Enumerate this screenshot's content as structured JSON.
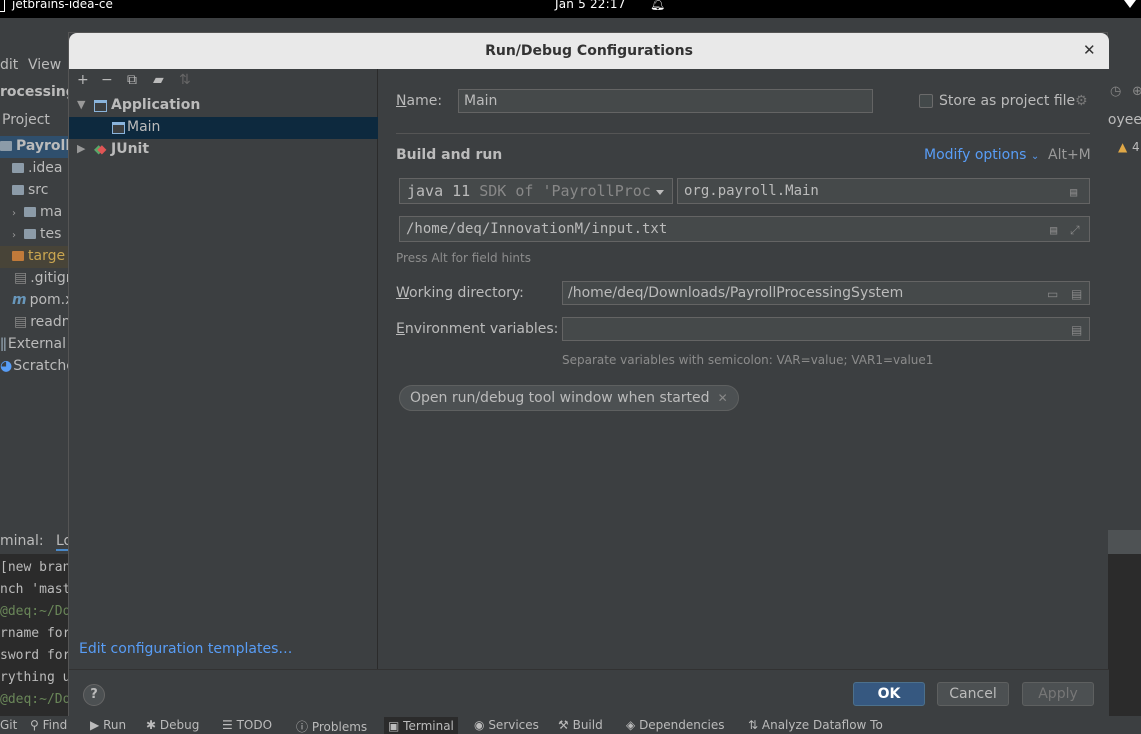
{
  "os": {
    "app_name": "jetbrains-idea-ce",
    "clock": "Jan 5  22:17"
  },
  "ide": {
    "menu": [
      "dit",
      "View"
    ],
    "project_title": "rocessing",
    "project_tab": "Project",
    "tree": [
      {
        "label": "PayrollP",
        "kind": "root"
      },
      {
        "label": ".idea",
        "kind": "folder"
      },
      {
        "label": "src",
        "kind": "folder"
      },
      {
        "label": "ma",
        "kind": "folder"
      },
      {
        "label": "tes",
        "kind": "folder"
      },
      {
        "label": "targe",
        "kind": "folder-orange"
      },
      {
        "label": ".gitign",
        "kind": "file"
      },
      {
        "label": "pom.x",
        "kind": "maven"
      },
      {
        "label": "readn",
        "kind": "file"
      },
      {
        "label": "External",
        "kind": "lib"
      },
      {
        "label": "Scratche",
        "kind": "scratch"
      }
    ],
    "terminal_tab": "minal:",
    "terminal_tab2": "Lo",
    "terminal_lines": [
      "[new bran",
      "nch 'mast",
      "@deq:~/Do",
      "rname for",
      "sword for",
      "rything u",
      "@deq:~/Do"
    ],
    "right_edge": {
      "text": "loyee",
      "warn": "4"
    },
    "statusbar": [
      "Git",
      "Find",
      "Run",
      "Debug",
      "TODO",
      "Problems",
      "Terminal",
      "Services",
      "Build",
      "Dependencies",
      "Analyze Dataflow To"
    ]
  },
  "dialog": {
    "title": "Run/Debug Configurations",
    "toolbar": [
      "+",
      "−"
    ],
    "tree": {
      "application": "Application",
      "main": "Main",
      "junit": "JUnit"
    },
    "edit_templates": "Edit configuration templates…",
    "name_label": "Name:",
    "name_value": "Main",
    "store_label": "Store as project file",
    "section_title": "Build and run",
    "modify_options": "Modify options",
    "modify_shortcut": "Alt+M",
    "sdk_main": "java 11",
    "sdk_rest": "SDK of 'PayrollProc",
    "main_class": "org.payroll.Main",
    "program_args": "/home/deq/InnovationM/input.txt",
    "field_hint": "Press Alt for field hints",
    "working_dir_label": "Working directory:",
    "working_dir_value": "/home/deq/Downloads/PayrollProcessingSystem",
    "env_label": "Environment variables:",
    "env_value": "",
    "env_hint": "Separate variables with semicolon: VAR=value; VAR1=value1",
    "chip": "Open run/debug tool window when started",
    "ok": "OK",
    "cancel": "Cancel",
    "apply": "Apply",
    "help": "?"
  }
}
